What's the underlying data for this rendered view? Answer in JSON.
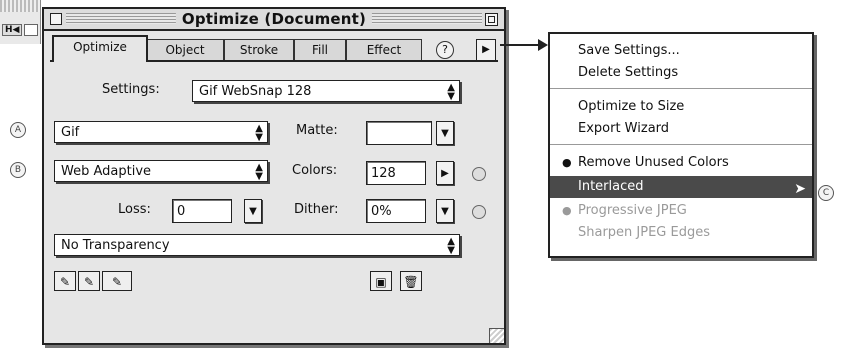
{
  "palette": {
    "title": "Optimize (Document)",
    "tabs": [
      "Optimize",
      "Object",
      "Stroke",
      "Fill",
      "Effect"
    ],
    "help_icon_text": "?",
    "settings_label": "Settings:",
    "settings_value": "Gif WebSnap 128",
    "format_value": "Gif",
    "palette_type_value": "Web Adaptive",
    "matte_label": "Matte:",
    "matte_value": "",
    "colors_label": "Colors:",
    "colors_value": "128",
    "loss_label": "Loss:",
    "loss_value": "0",
    "dither_label": "Dither:",
    "dither_value": "0%",
    "transparency_value": "No Transparency"
  },
  "callouts": [
    "A",
    "B",
    "C"
  ],
  "options_menu": {
    "items": [
      {
        "label": "Save Settings...",
        "state": "normal"
      },
      {
        "label": "Delete Settings",
        "state": "normal"
      },
      {
        "label": "Optimize to Size",
        "state": "normal"
      },
      {
        "label": "Export Wizard",
        "state": "normal"
      },
      {
        "label": "Remove Unused Colors",
        "state": "checked"
      },
      {
        "label": "Interlaced",
        "state": "highlighted"
      },
      {
        "label": "Progressive JPEG",
        "state": "disabled"
      },
      {
        "label": "Sharpen JPEG Edges",
        "state": "disabled"
      }
    ]
  },
  "background_window": {
    "nav_text": "H◀"
  },
  "icons": [
    "close-box-icon",
    "zoom-box-icon",
    "help-icon",
    "options-menu-arrow-icon",
    "eyedropper-add-icon",
    "eyedropper-remove-icon",
    "eyedropper-select-icon",
    "save-icon",
    "trash-icon",
    "pointer-cursor-icon"
  ],
  "colors": {
    "window_bg": "#e6e6e6",
    "menu_highlight": "#4a4a4a",
    "disabled_text": "#9a9a9a"
  }
}
